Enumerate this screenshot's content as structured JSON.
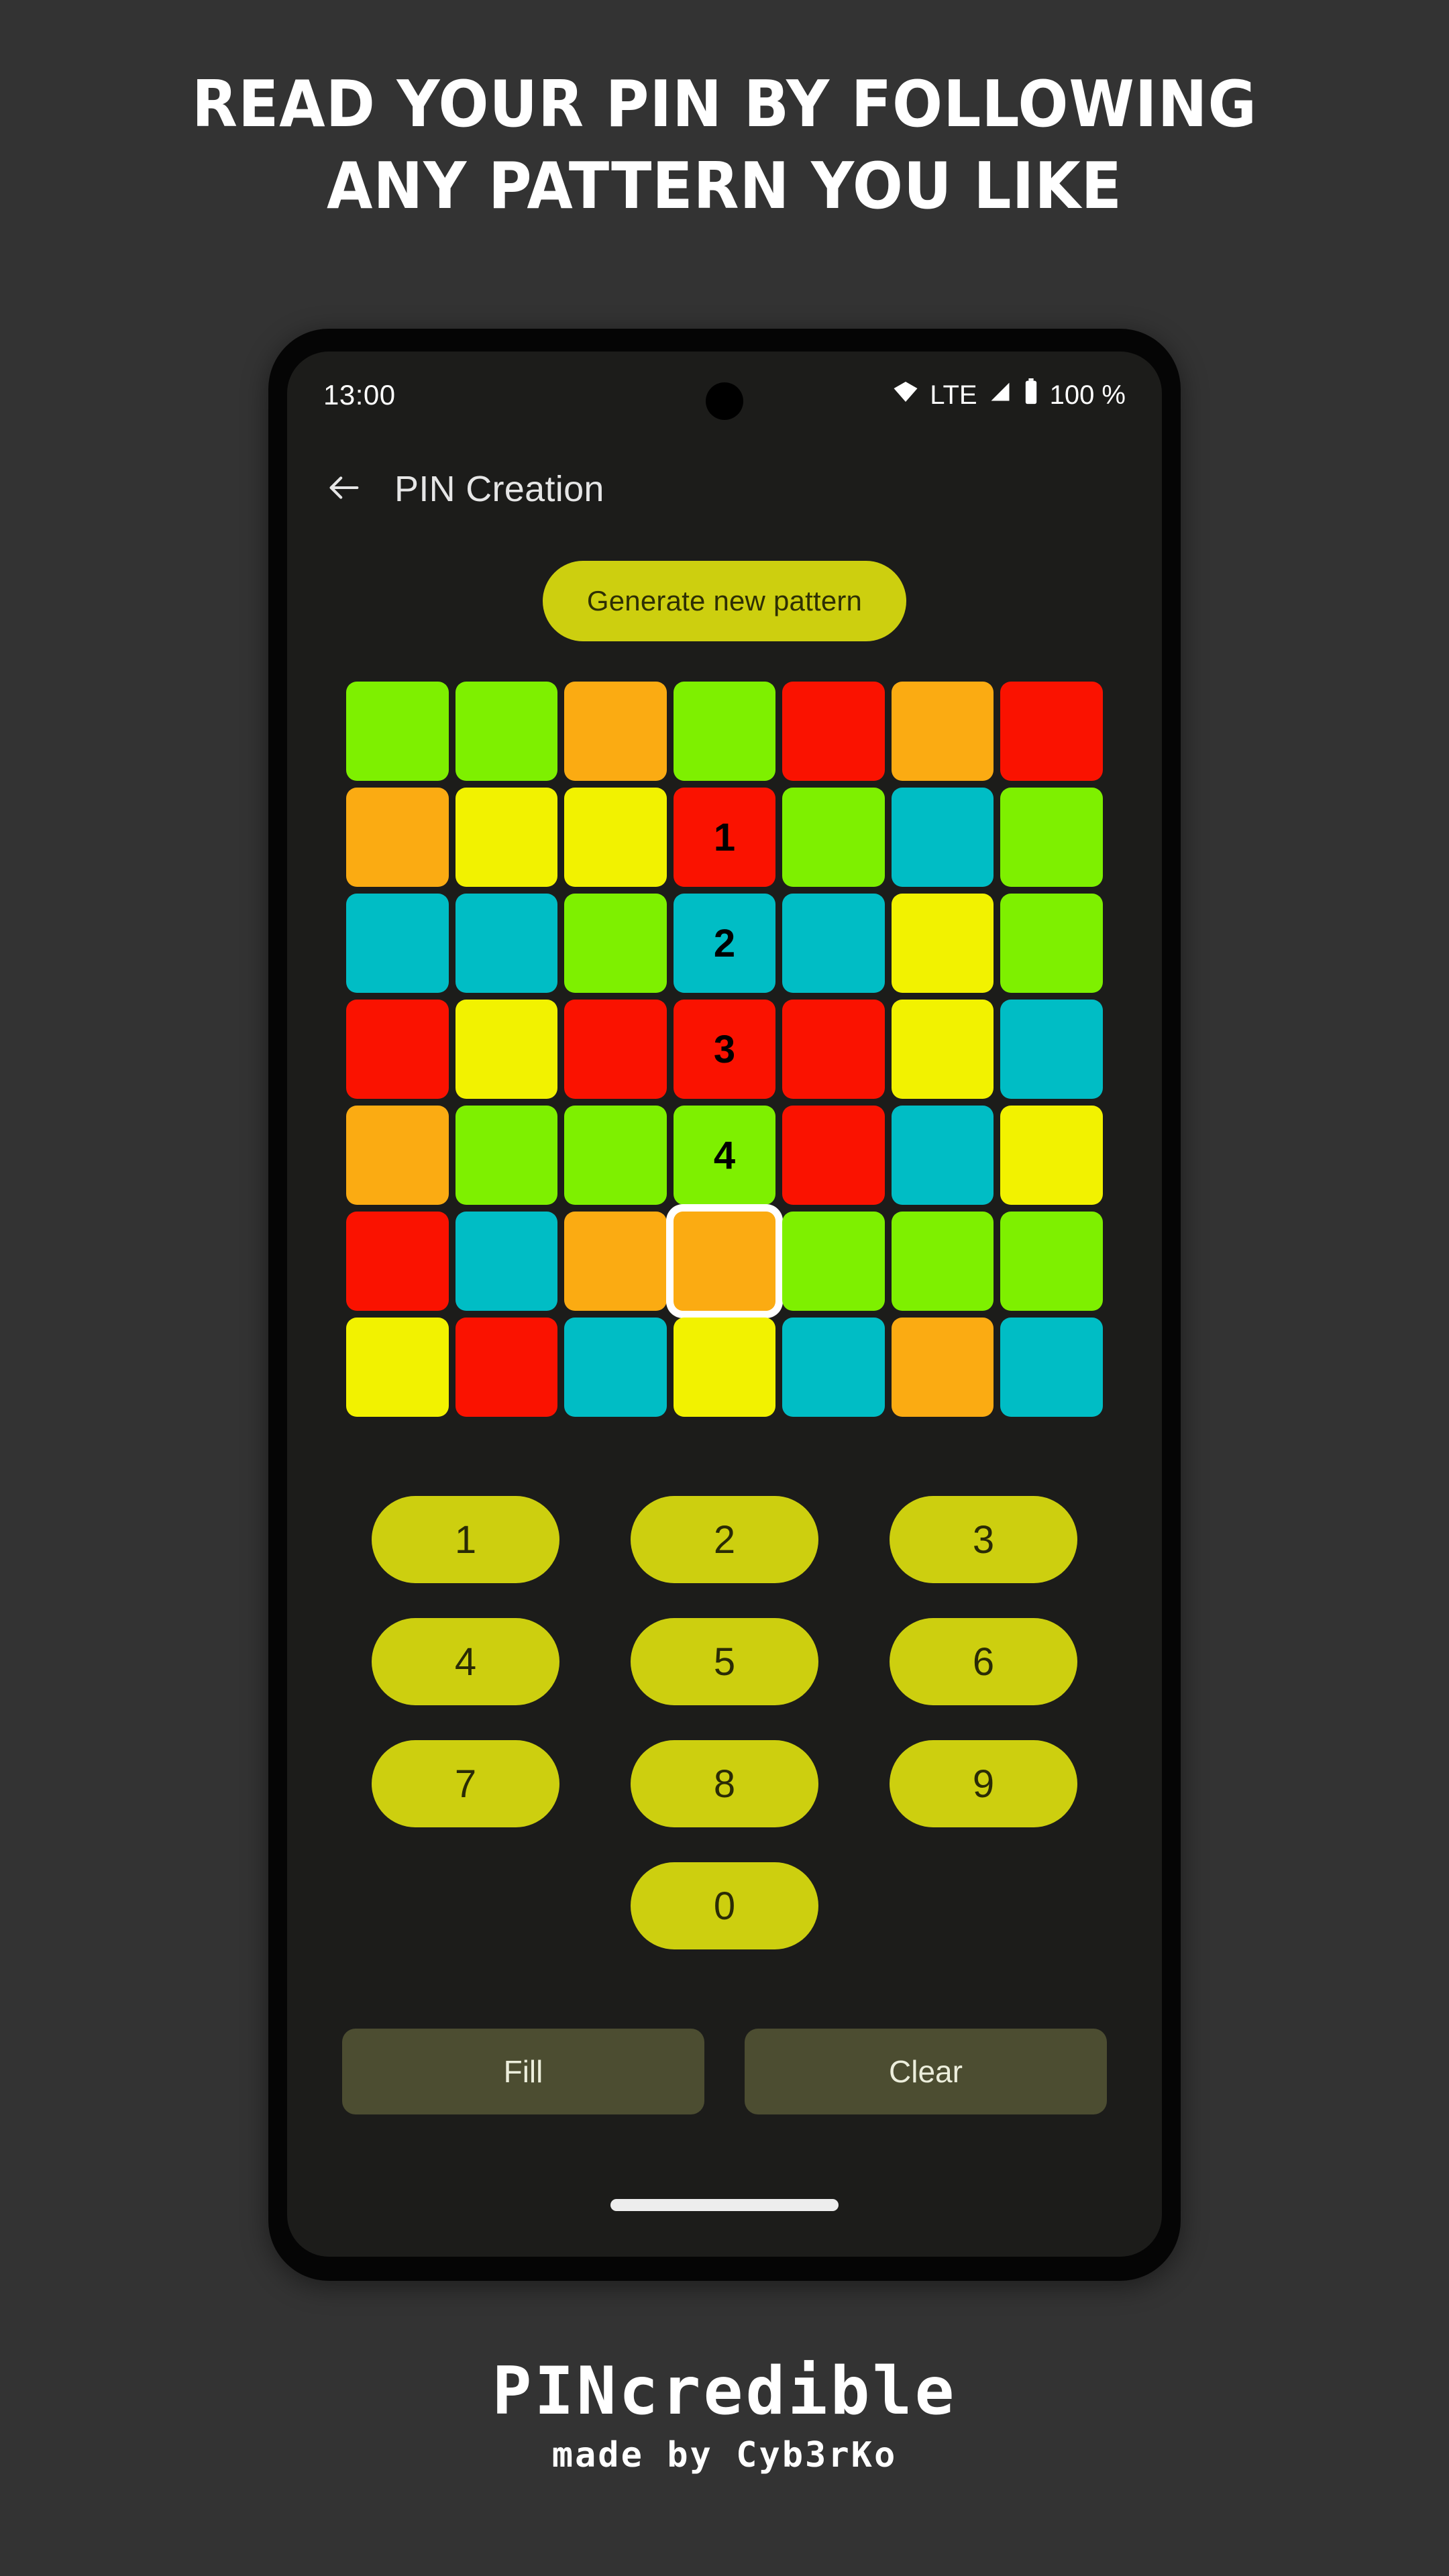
{
  "promo": {
    "headline_line1": "Read your PIN by following",
    "headline_line2": "any pattern you like"
  },
  "footer": {
    "app_name": "PINcredible",
    "credit": "made by Cyb3rKo"
  },
  "colors": {
    "page_background": "#333333",
    "phone_bezel": "#050505",
    "screen_background": "#1c1c1a",
    "accent": "#cdcf0f",
    "accent_text": "#2e2f04",
    "action_button": "#4c4d31",
    "action_button_text": "#eceedc",
    "tile_green": "#7ef000",
    "tile_orange": "#fbab12",
    "tile_red": "#fa1200",
    "tile_yellow": "#f2f200",
    "tile_cyan": "#00bdc5",
    "selection_border": "#ffffff",
    "title_text": "#e6e6e6"
  },
  "status_bar": {
    "time": "13:00",
    "network_label": "LTE",
    "battery_percent": "100 %",
    "icons": [
      "wifi-icon",
      "signal-icon",
      "battery-icon"
    ]
  },
  "app_bar": {
    "back_icon": "arrow-left-icon",
    "title": "PIN Creation"
  },
  "generate": {
    "label": "Generate new pattern"
  },
  "grid": {
    "rows": 7,
    "columns": 7,
    "tiles": [
      [
        {
          "color": "green",
          "label": ""
        },
        {
          "color": "green",
          "label": ""
        },
        {
          "color": "orange",
          "label": ""
        },
        {
          "color": "green",
          "label": ""
        },
        {
          "color": "red",
          "label": ""
        },
        {
          "color": "orange",
          "label": ""
        },
        {
          "color": "red",
          "label": ""
        }
      ],
      [
        {
          "color": "orange",
          "label": ""
        },
        {
          "color": "yellow",
          "label": ""
        },
        {
          "color": "yellow",
          "label": ""
        },
        {
          "color": "red",
          "label": "1"
        },
        {
          "color": "green",
          "label": ""
        },
        {
          "color": "cyan",
          "label": ""
        },
        {
          "color": "green",
          "label": ""
        }
      ],
      [
        {
          "color": "cyan",
          "label": ""
        },
        {
          "color": "cyan",
          "label": ""
        },
        {
          "color": "green",
          "label": ""
        },
        {
          "color": "cyan",
          "label": "2"
        },
        {
          "color": "cyan",
          "label": ""
        },
        {
          "color": "yellow",
          "label": ""
        },
        {
          "color": "green",
          "label": ""
        }
      ],
      [
        {
          "color": "red",
          "label": ""
        },
        {
          "color": "yellow",
          "label": ""
        },
        {
          "color": "red",
          "label": ""
        },
        {
          "color": "red",
          "label": "3"
        },
        {
          "color": "red",
          "label": ""
        },
        {
          "color": "yellow",
          "label": ""
        },
        {
          "color": "cyan",
          "label": ""
        }
      ],
      [
        {
          "color": "orange",
          "label": ""
        },
        {
          "color": "green",
          "label": ""
        },
        {
          "color": "green",
          "label": ""
        },
        {
          "color": "green",
          "label": "4"
        },
        {
          "color": "red",
          "label": ""
        },
        {
          "color": "cyan",
          "label": ""
        },
        {
          "color": "yellow",
          "label": ""
        }
      ],
      [
        {
          "color": "red",
          "label": ""
        },
        {
          "color": "cyan",
          "label": ""
        },
        {
          "color": "orange",
          "label": ""
        },
        {
          "color": "orange",
          "label": "",
          "selected": true
        },
        {
          "color": "green",
          "label": ""
        },
        {
          "color": "green",
          "label": ""
        },
        {
          "color": "green",
          "label": ""
        }
      ],
      [
        {
          "color": "yellow",
          "label": ""
        },
        {
          "color": "red",
          "label": ""
        },
        {
          "color": "cyan",
          "label": ""
        },
        {
          "color": "yellow",
          "label": ""
        },
        {
          "color": "cyan",
          "label": ""
        },
        {
          "color": "orange",
          "label": ""
        },
        {
          "color": "cyan",
          "label": ""
        }
      ]
    ]
  },
  "keypad": {
    "keys": [
      "1",
      "2",
      "3",
      "4",
      "5",
      "6",
      "7",
      "8",
      "9",
      "0"
    ]
  },
  "actions": {
    "fill_label": "Fill",
    "clear_label": "Clear"
  }
}
